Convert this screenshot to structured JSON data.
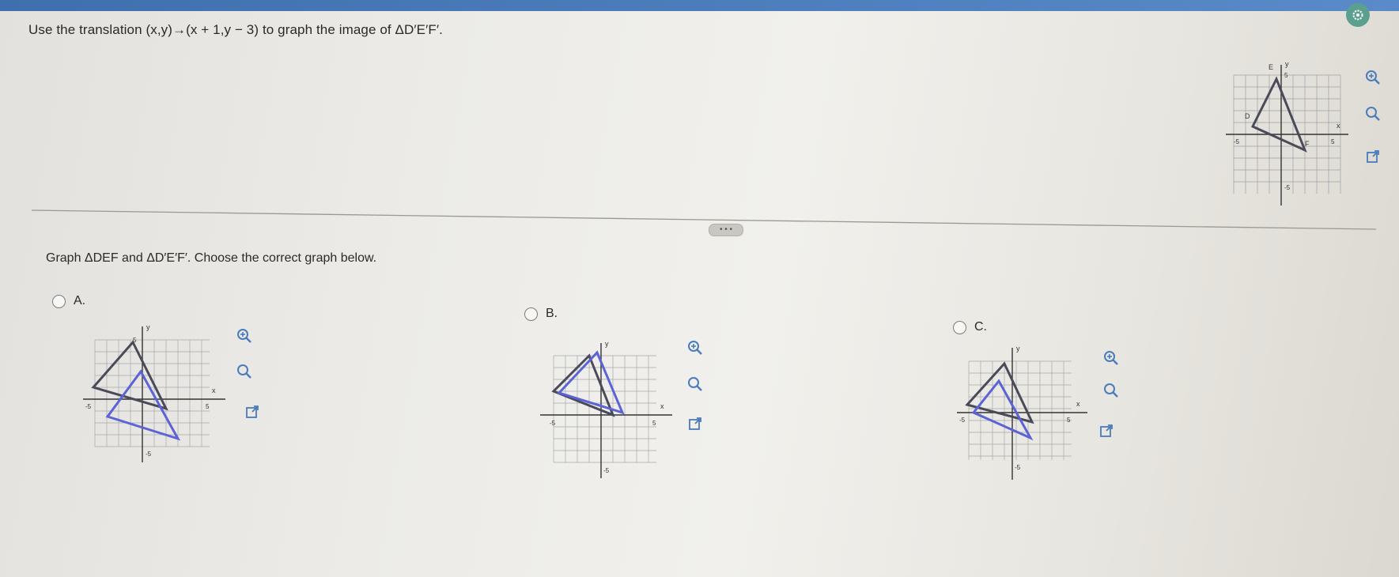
{
  "header": {
    "settings_icon": "gear-icon"
  },
  "question": {
    "text": "Use the translation (x,y)→(x + 1,y − 3) to graph the image of ΔD′E′F′."
  },
  "reference_graph": {
    "labels": {
      "e": "E",
      "y_axis": "y",
      "top_tick": "5",
      "d": "D",
      "x_axis": "x",
      "left_tick": "-5",
      "f": "F",
      "right_tick": "5",
      "bottom_tick": "-5"
    }
  },
  "toolbar_icons": [
    "zoom-in-icon",
    "zoom-out-icon",
    "expand-icon"
  ],
  "divider": {
    "more_label": "• • •"
  },
  "instruction": {
    "text": "Graph ΔDEF and ΔD′E′F′. Choose the correct graph below."
  },
  "choices": [
    {
      "label": "A."
    },
    {
      "label": "B."
    },
    {
      "label": "C."
    }
  ],
  "graph_labels": {
    "y": "y",
    "x": "x",
    "five": "5",
    "neg_five": "-5"
  },
  "colors": {
    "original_triangle": "#4a4a58",
    "image_triangle": "#5b63d6",
    "header": "#4a7bbb",
    "settings": "#5ba08f"
  }
}
